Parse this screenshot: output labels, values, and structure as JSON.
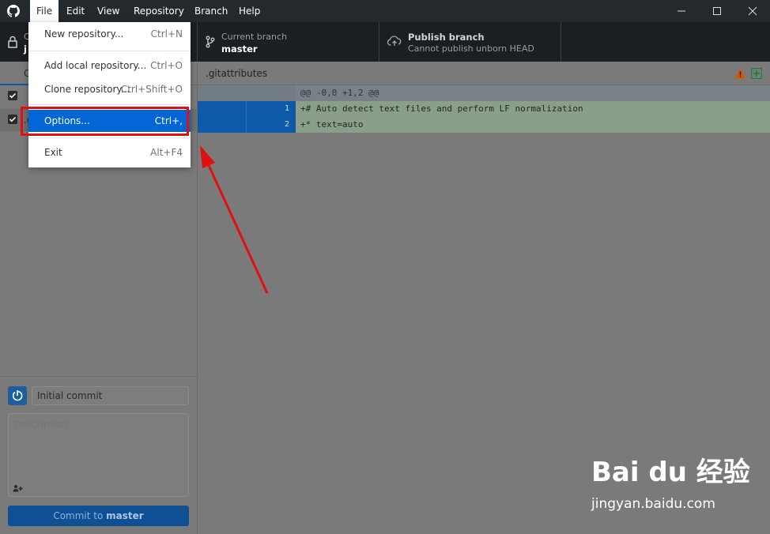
{
  "menubar": {
    "items": [
      "File",
      "Edit",
      "View",
      "Repository",
      "Branch",
      "Help"
    ]
  },
  "toolbar": {
    "repository": {
      "label": "C",
      "value": "j"
    },
    "branch": {
      "label": "Current branch",
      "value": "master"
    },
    "publish": {
      "label": "Publish branch",
      "value": "Cannot publish unborn HEAD"
    }
  },
  "sidebar": {
    "tab_label": "C",
    "files": [
      {
        "name": "",
        "checked": true
      },
      {
        "name": ".g",
        "checked": true
      }
    ]
  },
  "commit": {
    "summary_value": "Initial commit",
    "description_placeholder": "Description",
    "coauthor_label": "+",
    "button_prefix": "Commit to ",
    "button_branch": "master"
  },
  "diff": {
    "filename": ".gitattributes",
    "hunk_header": "@@ -0,0 +1,2 @@",
    "lines": [
      {
        "new_no": "1",
        "text": "+# Auto detect text files and perform LF normalization"
      },
      {
        "new_no": "2",
        "text": "+* text=auto"
      }
    ]
  },
  "file_menu": {
    "items": [
      {
        "label": "New repository...",
        "shortcut": "Ctrl+N"
      },
      {
        "label": "Add local repository...",
        "shortcut": "Ctrl+O"
      },
      {
        "label": "Clone repository...",
        "shortcut": "Ctrl+Shift+O"
      },
      {
        "label": "Options...",
        "shortcut": "Ctrl+,"
      },
      {
        "label": "Exit",
        "shortcut": "Alt+F4"
      }
    ]
  },
  "watermark": {
    "logo": "Bai du 经验",
    "url": "jingyan.baidu.com"
  },
  "colors": {
    "highlight": "#0366d6",
    "annotation": "#e01010",
    "commit_button": "#0f4f93"
  }
}
